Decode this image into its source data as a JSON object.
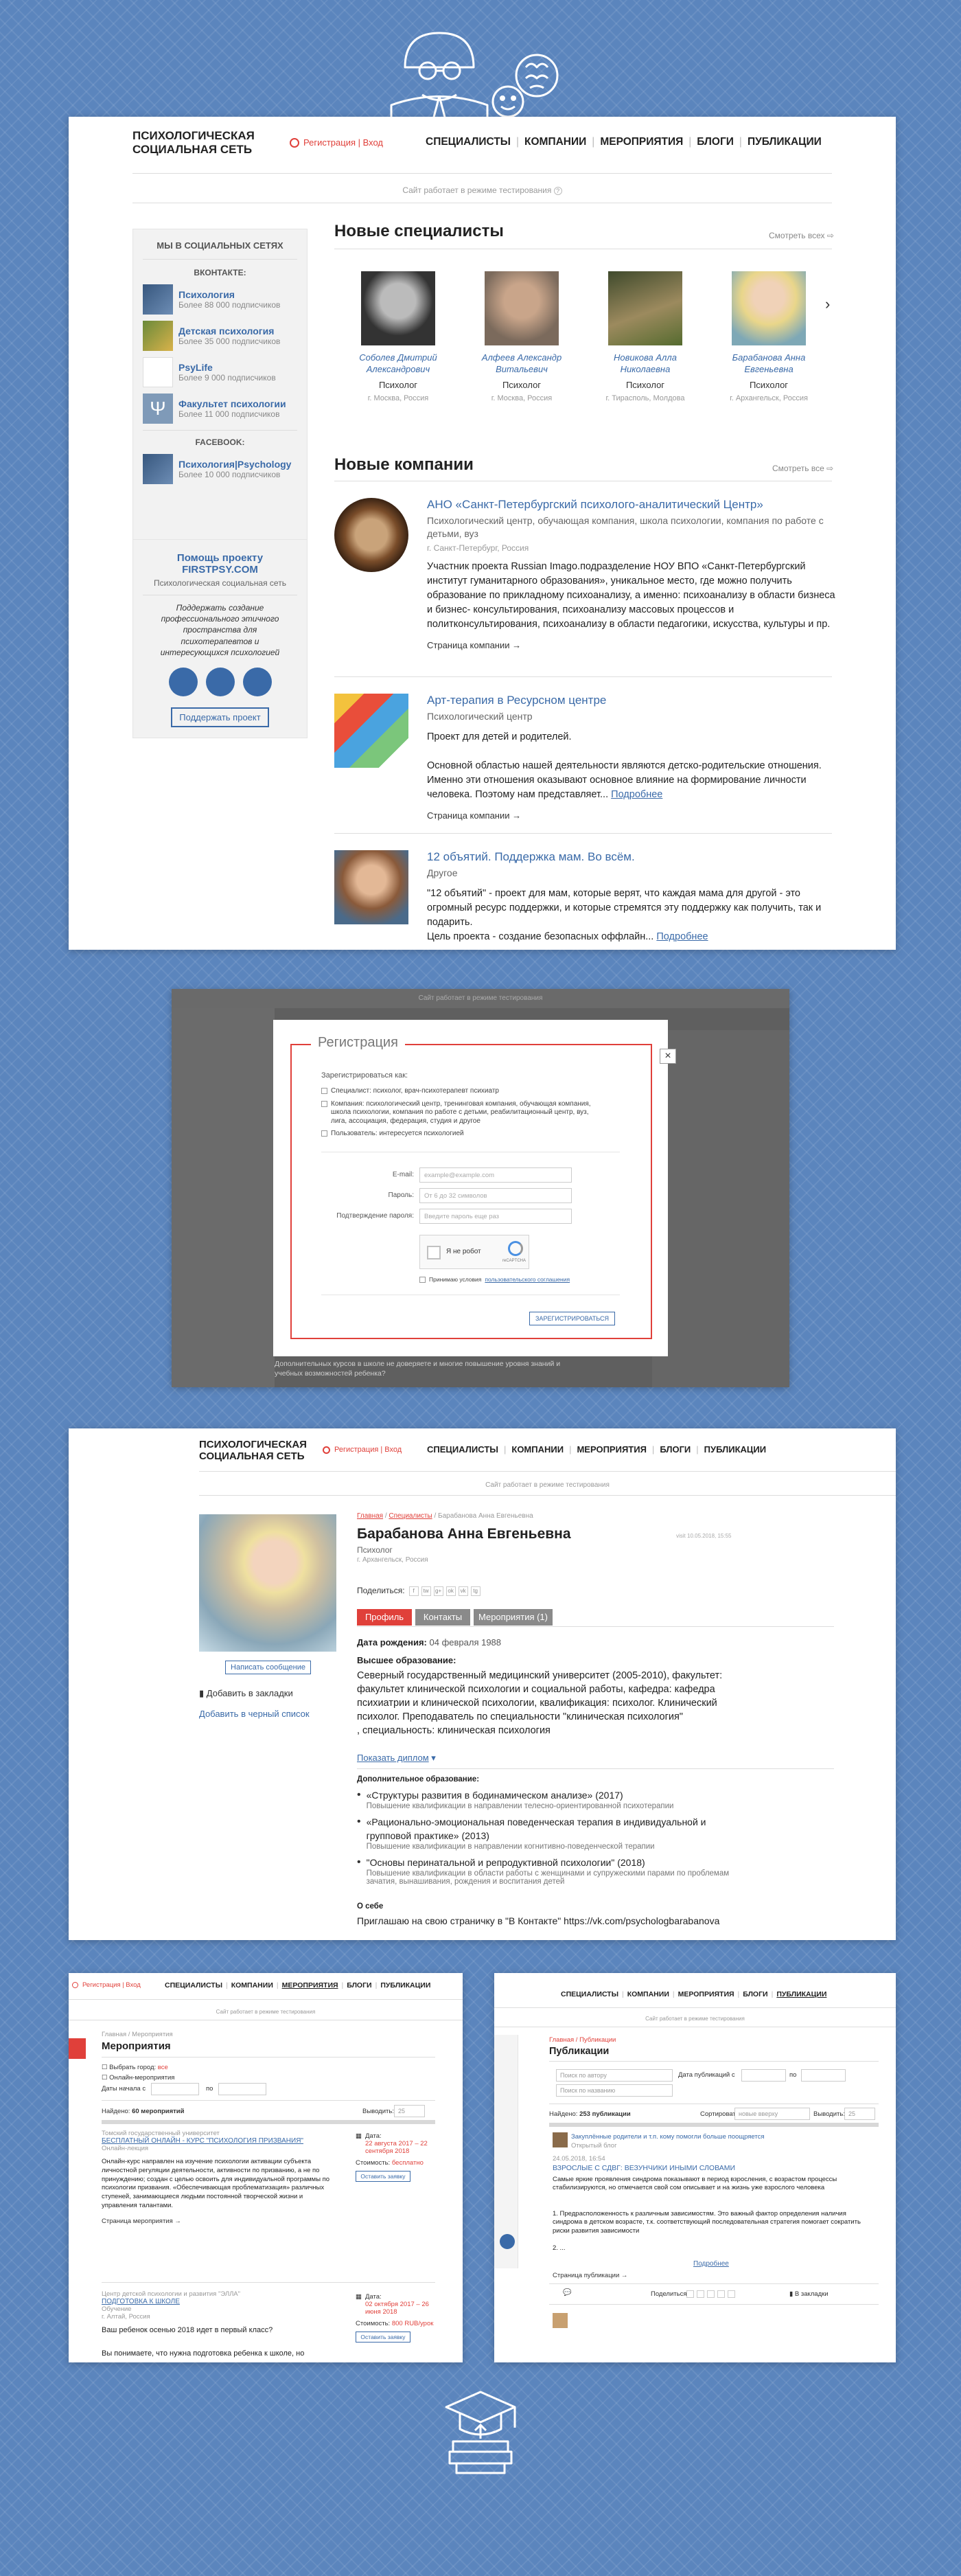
{
  "header": {
    "logo_line1": "ПСИХОЛОГИЧЕСКАЯ",
    "logo_line2": "СОЦИАЛЬНАЯ СЕТЬ",
    "reg_login": "Регистрация | Вход",
    "nav": [
      "СПЕЦИАЛИСТЫ",
      "КОМПАНИИ",
      "МЕРОПРИЯТИЯ",
      "БЛОГИ",
      "ПУБЛИКАЦИИ"
    ],
    "testing": "Сайт работает в режиме тестирования"
  },
  "sidebar": {
    "social_title": "МЫ В СОЦИАЛЬНЫХ СЕТЯХ",
    "vk_title": "ВКОНТАКТЕ:",
    "vk_items": [
      {
        "name": "Психология",
        "sub": "Более 88 000 подписчиков"
      },
      {
        "name": "Детская психология",
        "sub": "Более 35 000 подписчиков"
      },
      {
        "name": "PsyLife",
        "sub": "Более 9 000 подписчиков"
      },
      {
        "name": "Факультет психологии",
        "sub": "Более 11 000 подписчиков"
      }
    ],
    "fb_title": "FACEBOOK:",
    "fb_items": [
      {
        "name": "Психология|Psychology",
        "sub": "Более 10 000 подписчиков"
      }
    ],
    "help_title": "Помощь проекту",
    "help_site": "FIRSTPSY.COM",
    "help_sub": "Психологическая социальная сеть",
    "help_text": "Поддержать создание профессионального этичного пространства для психотерапевтов и интересующихся психологией",
    "help_button": "Поддержать проект"
  },
  "specialists": {
    "title": "Новые специалисты",
    "see_all": "Смотреть всех",
    "items": [
      {
        "name": "Соболев Дмитрий Александрович",
        "role": "Психолог",
        "loc": "г. Москва, Россия"
      },
      {
        "name": "Алфеев Александр Витальевич",
        "role": "Психолог",
        "loc": "г. Москва, Россия"
      },
      {
        "name": "Новикова Алла Николаевна",
        "role": "Психолог",
        "loc": "г. Тирасполь, Молдова"
      },
      {
        "name": "Барабанова Анна Евгеньевна",
        "role": "Психолог",
        "loc": "г. Архангельск, Россия"
      }
    ]
  },
  "companies": {
    "title": "Новые компании",
    "see_all": "Смотреть все",
    "page_link": "Страница компании",
    "more": "Подробнее",
    "items": [
      {
        "title": "АНО «Санкт-Петербургский психолого-аналитический Центр»",
        "type": "Психологический центр, обучающая компания, школа психологии, компания по работе с детьми, вуз",
        "city": "г. Санкт-Петербург, Россия",
        "desc": "Участник проекта Russian Imago.подразделение НОУ ВПО «Санкт-Петербургский институт гуманитарного образования», уникальное место, где можно получить образование по прикладному психоанализу, а именно: психоанализу в области бизнеса и бизнес- консультирования, психоанализу массовых процессов и политконсультирования, психоанализу в области педагогики, искусства, культуры и пр."
      },
      {
        "title": "Арт-терапия в Ресурсном центре",
        "type": "Психологический центр",
        "city": "",
        "desc": "Проект для детей и родителей.\n\nОсновной областью нашей деятельности являются детско-родительские отношения. Именно эти отношения оказывают основное влияние на формирование личности человека. Поэтому нам представляет..."
      },
      {
        "title": "12 объятий. Поддержка мам. Во всём.",
        "type": "Другое",
        "city": "",
        "desc": "\"12 объятий\" - проект для мам, которые верят, что каждая мама для другой - это огромный ресурс поддержки, и которые стремятся эту поддержку как получить, так и подарить.\nЦель проекта - создание безопасных оффлайн..."
      }
    ]
  },
  "modal": {
    "title": "Регистрация",
    "register_as": "Зарегистрироваться как:",
    "options": [
      "Специалист: психолог, врач-психотерапевт психиатр",
      "Компания: психологический центр, тренинговая компания, обучающая компания, школа психологии, компания по работе с детьми, реабилитационный центр, вуз, лига, ассоциация, федерация, студия и другое",
      "Пользователь: интересуется психологией"
    ],
    "email_label": "E-mail:",
    "email_placeholder": "example@example.com",
    "password_label": "Пароль:",
    "password_placeholder": "От 6 до 32 символов",
    "confirm_label": "Подтверждение пароля:",
    "confirm_placeholder": "Введите пароль еще раз",
    "captcha": "Я не робот",
    "captcha_brand": "reCAPTCHA",
    "terms_prefix": "Принимаю условия",
    "terms_link": "пользовательского соглашения",
    "submit": "ЗАРЕГИСТРИРОВАТЬСЯ",
    "close": "×",
    "bg_text": "Дополнительных курсов в школе не доверяете и многие повышение уровня знаний и учебных возможностей ребенка?"
  },
  "profile": {
    "breadcrumb": [
      "Главная",
      "Специалисты",
      "Барабанова Анна Евгеньевна"
    ],
    "name": "Барабанова Анна Евгеньевна",
    "role": "Психолог",
    "loc": "г. Архангельск, Россия",
    "online": "visit 10.05.2018, 15:55",
    "share": "Поделиться:",
    "share_icons": [
      "f",
      "tw",
      "g+",
      "ok",
      "vk",
      "tg"
    ],
    "tabs": [
      "Профиль",
      "Контакты",
      "Мероприятия (1)"
    ],
    "write_button": "Написать сообщение",
    "bookmark": "Добавить в закладки",
    "blacklist": "Добавить в черный список",
    "birth_label": "Дата рождения:",
    "birth": "04 февраля 1988",
    "higher_ed_title": "Высшее образование:",
    "higher_ed": "Северный государственный медицинский университет (2005-2010), факультет: факультет клинической психологии и социальной работы, кафедра: кафедра психиатрии и клинической психологии, квалификация: психолог. Клинический психолог. Преподаватель по специальности \"клиническая психология\"\n, специальность: клиническая психология",
    "show_diploma": "Показать диплом",
    "add_ed_title": "Дополнительное образование:",
    "add_ed": [
      {
        "title": "«Структуры развития в бодинамическом анализе» (2017)",
        "sub": "Повышение квалификации в направлении телесно-ориентированной психотерапии"
      },
      {
        "title": "«Рационально-эмоциональная поведенческая терапия в индивидуальной и групповой практике» (2013)",
        "sub": "Повышение квалификации в направлении когнитивно-поведенческой терапии"
      },
      {
        "title": "\"Основы перинатальной и репродуктивной психологии\" (2018)",
        "sub": "Повышение квалификации в области работы с женщинами и супружескими парами по проблемам зачатия, вынашивания, рождения и воспитания детей"
      }
    ],
    "about_title": "О себе",
    "about": "Приглашаю на свою страничку в \"В Контакте\" https://vk.com/psychologbarabanova"
  },
  "events": {
    "reg": "Регистрация | Вход",
    "nav": [
      "СПЕЦИАЛИСТЫ",
      "КОМПАНИИ",
      "МЕРОПРИЯТИЯ",
      "БЛОГИ",
      "ПУБЛИКАЦИИ"
    ],
    "testing": "Сайт работает в режиме тестирования",
    "breadcrumb": "Главная / Мероприятия",
    "title": "Мероприятия",
    "filter1": "Выбрать город:",
    "filter1_val": "все",
    "filter2": "Онлайн-мероприятия",
    "dates_label": "Даты начала с",
    "to": "по",
    "found": "Найдено:",
    "found_count": "60 мероприятий",
    "show": "Выводить:",
    "show_val": "25",
    "items": [
      {
        "org": "Томский государственный университет",
        "title": "БЕСПЛАТНЫЙ ОНЛАЙН - КУРС \"ПСИХОЛОГИЯ ПРИЗВАНИЯ\"",
        "type": "Онлайн-лекция",
        "desc": "Онлайн-курс направлен на изучение психологии активации субъекта личностной регуляции деятельности, активности по призванию, а не по принуждению; создан с целью освоить для индивидуальной программы по психологии призвания. «Обеспечивающая проблематизация» различных ступеней, занимающиеся людьми постоянной творческой жизни и управления талантами.",
        "date_label": "Дата:",
        "date": "22 августа 2017 – 22 сентября 2018",
        "cost_label": "Стоимость:",
        "cost": "бесплатно",
        "btn": "Оставить заявку",
        "page": "Страница мероприятия"
      },
      {
        "org": "Центр детской психологии и развития \"ЭЛЛА\"",
        "title": "ПОДГОТОВКА К ШКОЛЕ",
        "type": "Обучение",
        "city": "г. Алтай, Россия",
        "desc": "Ваш ребенок осенью 2018 идет в первый класс?",
        "desc2": "Вы понимаете, что нужна подготовка ребенка к школе, но",
        "date_label": "Дата:",
        "date": "02 октября 2017 – 26 июня 2018",
        "cost_label": "Стоимость:",
        "cost": "800 RUB/урок",
        "btn": "Оставить заявку"
      }
    ]
  },
  "publications": {
    "nav": [
      "СПЕЦИАЛИСТЫ",
      "КОМПАНИИ",
      "МЕРОПРИЯТИЯ",
      "БЛОГИ",
      "ПУБЛИКАЦИИ"
    ],
    "testing": "Сайт работает в режиме тестирования",
    "breadcrumb": "Главная / Публикации",
    "title": "Публикации",
    "search_author": "Поиск по автору",
    "date_from": "Дата публикаций с",
    "to": "по",
    "search_name": "Поиск по названию",
    "found": "Найдено:",
    "found_count": "253 публикации",
    "sort": "Сортировать:",
    "sort_val": "новые вверху",
    "show": "Выводить:",
    "show_val": "25",
    "post": {
      "author": "Закуплённые родители и т.п. кому помогли больше поощряется",
      "blog": "Открытый блог",
      "date": "24.05.2018, 16:54",
      "title": "ВЗРОСЛЫЕ С СДВГ: ВЕЗУНЧИКИ ИНЫМИ СЛОВАМИ",
      "text": "Самые яркие проявления синдрома показывают в период взросления, с возрастом процессы стабилизируются, но отмечается свой сом описывает и на жизнь уже взрослого человека",
      "text2": "1. Предрасположенность к различным зависимостям. Это важный фактор определения наличия синдрома в детском возрасте, т.к. соответствующий последовательная стратегия помогает сократить риски развития зависимости",
      "more": "Подробнее",
      "page": "Страница публикации",
      "share": "Поделиться",
      "bookmark": "В закладки"
    }
  }
}
